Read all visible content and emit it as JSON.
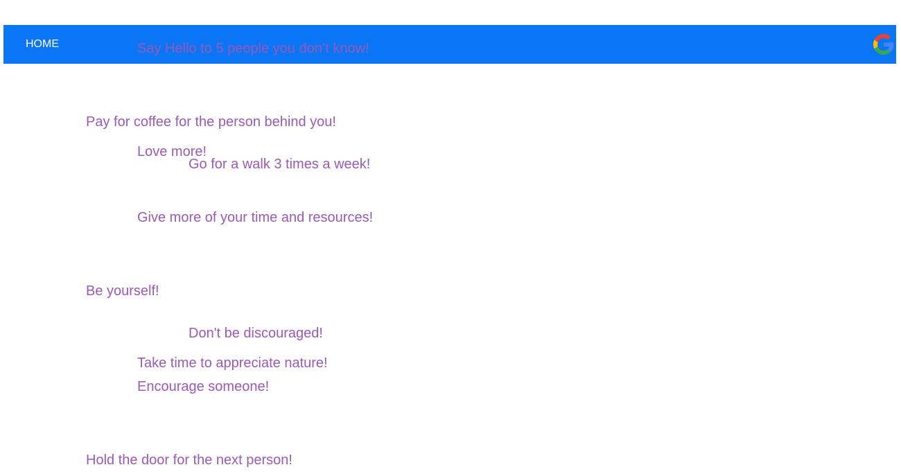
{
  "nav": {
    "home_label": "HOME",
    "icon": "google-g-icon"
  },
  "colors": {
    "navbar_bg": "#0a75f5",
    "nav_text": "#ffffff",
    "message_text": "#9b59b6"
  },
  "messages": [
    "Say Hello to 5 people you don’t know!",
    "Pay for coffee for the person behind you!",
    "Love more!",
    "Go for a walk 3 times a week!",
    "Give more of your time and resources!",
    "Be yourself!",
    "Don't be discouraged!",
    "Take time to appreciate nature!",
    "Encourage someone!",
    "Hold the door for the next person!"
  ]
}
